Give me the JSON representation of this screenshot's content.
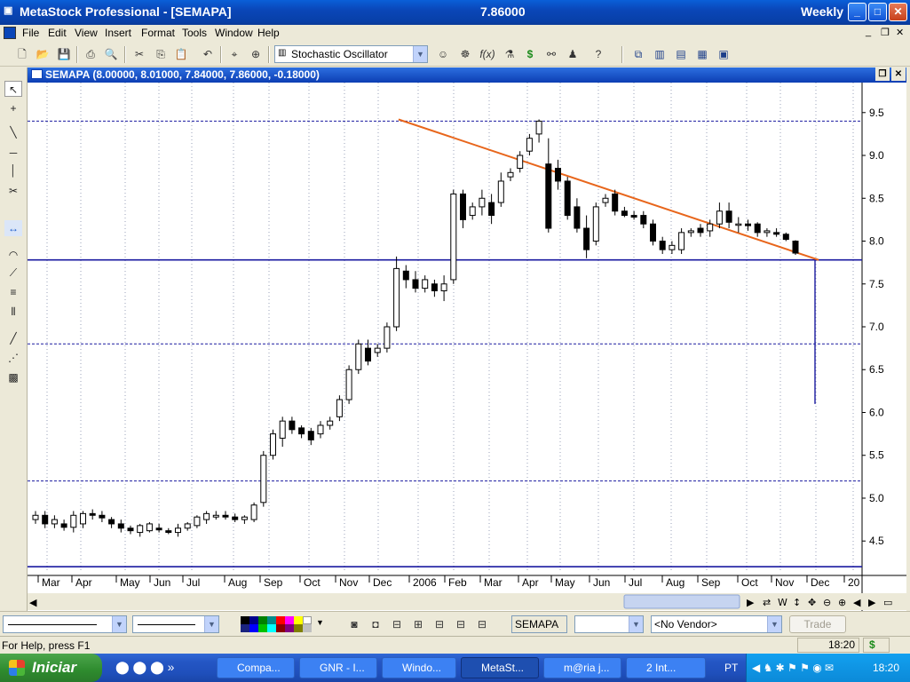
{
  "window": {
    "title": "MetaStock Professional - [SEMAPA]",
    "price": "7.86000",
    "period": "Weekly",
    "btn_min": "_",
    "btn_max": "□",
    "btn_close": "✕"
  },
  "menu": [
    "File",
    "Edit",
    "View",
    "Insert",
    "Format",
    "Tools",
    "Window",
    "Help"
  ],
  "toolbar": {
    "indicator": "Stochastic Oscillator"
  },
  "child": {
    "title": "SEMAPA (8.00000, 8.01000, 7.84000, 7.86000, -0.18000)"
  },
  "bottom": {
    "security": "SEMAPA",
    "vendor": "<No Vendor>",
    "trade": "Trade"
  },
  "status": {
    "help": "For Help, press F1",
    "time": "18:20",
    "dollar": "$"
  },
  "taskbar": {
    "start": "Iniciar",
    "tasks": [
      "Compa...",
      "GNR - I...",
      "Windo...",
      "MetaSt...",
      "m@ria j...",
      "2 Int..."
    ],
    "lang": "PT",
    "clock": "18:20"
  },
  "chart_data": {
    "type": "candlestick",
    "y_ticks": [
      "9.5",
      "9.0",
      "8.5",
      "8.0",
      "7.5",
      "7.0",
      "6.5",
      "6.0",
      "5.5",
      "5.0",
      "4.5"
    ],
    "x_labels": [
      "Mar",
      "Apr",
      "May",
      "Jun",
      "Jul",
      "Aug",
      "Sep",
      "Oct",
      "Nov",
      "Dec",
      "2006",
      "Feb",
      "Mar",
      "Apr",
      "May",
      "Jun",
      "Jul",
      "Aug",
      "Sep",
      "Oct",
      "Nov",
      "Dec",
      "20"
    ],
    "ylim": [
      4.15,
      9.85
    ],
    "horizontal_lines": [
      9.4,
      7.78,
      6.8,
      5.2,
      4.2
    ],
    "trendline": {
      "from": [
        37,
        9.42
      ],
      "to": [
        44.5,
        7.78
      ]
    },
    "vertical_line": {
      "x": 44.5,
      "y_from": 7.78,
      "y_to": 6.1
    },
    "candles": [
      [
        0,
        4.75,
        4.85,
        4.7,
        4.8
      ],
      [
        1,
        4.8,
        4.85,
        4.65,
        4.7
      ],
      [
        2,
        4.7,
        4.8,
        4.65,
        4.75
      ],
      [
        3,
        4.7,
        4.75,
        4.62,
        4.66
      ],
      [
        4,
        4.66,
        4.85,
        4.6,
        4.8
      ],
      [
        5,
        4.7,
        4.85,
        4.65,
        4.82
      ],
      [
        6,
        4.82,
        4.87,
        4.75,
        4.8
      ],
      [
        7,
        4.8,
        4.85,
        4.72,
        4.77
      ],
      [
        8,
        4.75,
        4.78,
        4.65,
        4.7
      ],
      [
        9,
        4.7,
        4.75,
        4.6,
        4.65
      ],
      [
        10,
        4.65,
        4.68,
        4.58,
        4.62
      ],
      [
        11,
        4.6,
        4.7,
        4.55,
        4.68
      ],
      [
        12,
        4.62,
        4.72,
        4.6,
        4.7
      ],
      [
        13,
        4.65,
        4.7,
        4.6,
        4.63
      ],
      [
        14,
        4.62,
        4.65,
        4.58,
        4.6
      ],
      [
        15,
        4.6,
        4.7,
        4.55,
        4.65
      ],
      [
        16,
        4.65,
        4.72,
        4.62,
        4.7
      ],
      [
        17,
        4.68,
        4.8,
        4.65,
        4.78
      ],
      [
        18,
        4.75,
        4.85,
        4.7,
        4.82
      ],
      [
        19,
        4.78,
        4.85,
        4.75,
        4.8
      ],
      [
        20,
        4.8,
        4.85,
        4.75,
        4.78
      ],
      [
        21,
        4.78,
        4.82,
        4.72,
        4.75
      ],
      [
        22,
        4.75,
        4.8,
        4.7,
        4.78
      ],
      [
        23,
        4.75,
        4.95,
        4.72,
        4.92
      ],
      [
        24,
        4.95,
        5.55,
        4.9,
        5.5
      ],
      [
        25,
        5.5,
        5.8,
        5.45,
        5.75
      ],
      [
        26,
        5.7,
        5.95,
        5.6,
        5.9
      ],
      [
        27,
        5.9,
        5.95,
        5.75,
        5.8
      ],
      [
        28,
        5.82,
        5.85,
        5.7,
        5.75
      ],
      [
        29,
        5.78,
        5.82,
        5.62,
        5.68
      ],
      [
        30,
        5.75,
        5.9,
        5.7,
        5.85
      ],
      [
        31,
        5.85,
        5.95,
        5.8,
        5.9
      ],
      [
        32,
        5.95,
        6.2,
        5.9,
        6.15
      ],
      [
        33,
        6.15,
        6.55,
        6.1,
        6.5
      ],
      [
        34,
        6.5,
        6.85,
        6.45,
        6.8
      ],
      [
        35,
        6.75,
        6.85,
        6.55,
        6.6
      ],
      [
        36,
        6.7,
        6.8,
        6.65,
        6.75
      ],
      [
        37,
        6.75,
        7.05,
        6.7,
        7.0
      ],
      [
        38,
        7.0,
        7.82,
        6.95,
        7.68
      ],
      [
        39,
        7.65,
        7.72,
        7.45,
        7.55
      ],
      [
        40,
        7.55,
        7.65,
        7.4,
        7.45
      ],
      [
        41,
        7.45,
        7.6,
        7.4,
        7.55
      ],
      [
        42,
        7.5,
        7.55,
        7.35,
        7.42
      ],
      [
        43,
        7.42,
        7.6,
        7.3,
        7.5
      ],
      [
        44,
        7.55,
        8.6,
        7.5,
        8.55
      ],
      [
        45,
        8.55,
        8.6,
        8.15,
        8.25
      ],
      [
        46,
        8.3,
        8.45,
        8.25,
        8.4
      ],
      [
        47,
        8.4,
        8.6,
        8.3,
        8.5
      ],
      [
        48,
        8.45,
        8.55,
        8.2,
        8.3
      ],
      [
        49,
        8.45,
        8.8,
        8.4,
        8.7
      ],
      [
        50,
        8.75,
        8.85,
        8.7,
        8.8
      ],
      [
        51,
        8.85,
        9.05,
        8.8,
        9.0
      ],
      [
        52,
        9.05,
        9.25,
        9.0,
        9.2
      ],
      [
        53,
        9.25,
        9.42,
        9.15,
        9.4
      ],
      [
        54,
        8.9,
        9.2,
        8.1,
        8.15
      ],
      [
        55,
        8.85,
        8.95,
        8.6,
        8.7
      ],
      [
        56,
        8.7,
        8.75,
        8.25,
        8.3
      ],
      [
        57,
        8.4,
        8.5,
        8.1,
        8.15
      ],
      [
        58,
        8.15,
        8.3,
        7.8,
        7.9
      ],
      [
        59,
        8.0,
        8.45,
        7.95,
        8.4
      ],
      [
        60,
        8.45,
        8.55,
        8.4,
        8.5
      ],
      [
        61,
        8.55,
        8.6,
        8.3,
        8.35
      ],
      [
        62,
        8.35,
        8.4,
        8.28,
        8.3
      ],
      [
        63,
        8.3,
        8.35,
        8.25,
        8.28
      ],
      [
        64,
        8.3,
        8.35,
        8.15,
        8.2
      ],
      [
        65,
        8.2,
        8.25,
        7.95,
        8.0
      ],
      [
        66,
        8.0,
        8.05,
        7.85,
        7.9
      ],
      [
        67,
        7.9,
        8.0,
        7.85,
        7.95
      ],
      [
        68,
        7.9,
        8.15,
        7.85,
        8.1
      ],
      [
        69,
        8.1,
        8.15,
        8.05,
        8.12
      ],
      [
        70,
        8.15,
        8.2,
        8.05,
        8.1
      ],
      [
        71,
        8.12,
        8.25,
        8.05,
        8.2
      ],
      [
        72,
        8.2,
        8.45,
        8.15,
        8.35
      ],
      [
        73,
        8.35,
        8.45,
        8.15,
        8.22
      ],
      [
        74,
        8.2,
        8.28,
        8.1,
        8.2
      ],
      [
        75,
        8.2,
        8.25,
        8.12,
        8.18
      ],
      [
        76,
        8.2,
        8.22,
        8.05,
        8.1
      ],
      [
        77,
        8.1,
        8.15,
        8.05,
        8.12
      ],
      [
        78,
        8.1,
        8.15,
        8.05,
        8.08
      ],
      [
        79,
        8.08,
        8.1,
        8.0,
        8.02
      ],
      [
        80,
        8.0,
        8.01,
        7.84,
        7.86
      ]
    ]
  }
}
